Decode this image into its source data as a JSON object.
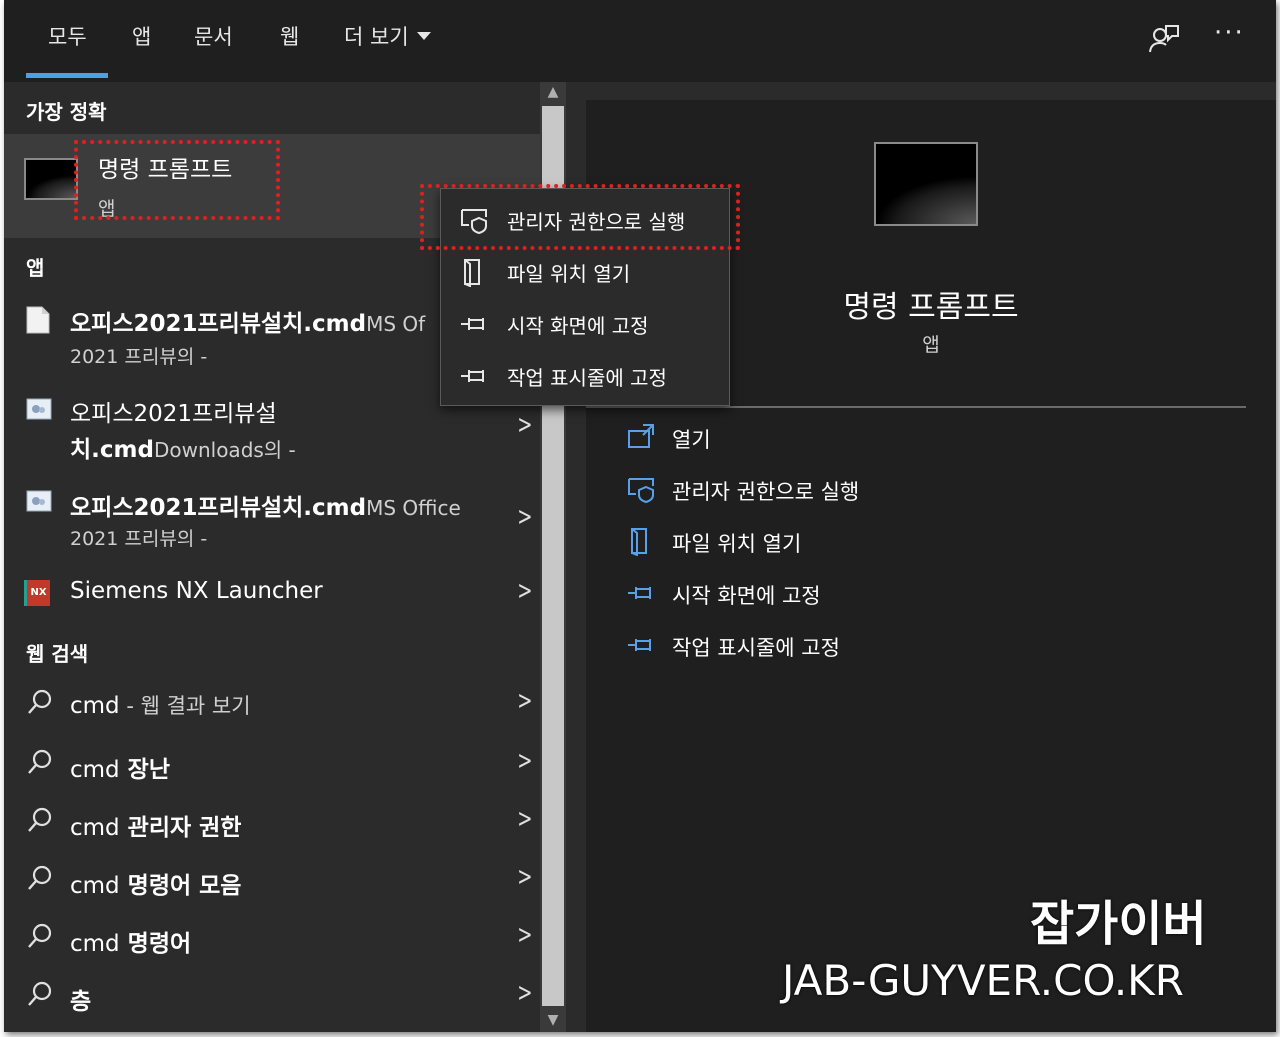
{
  "tabs": [
    {
      "label": "모두",
      "active": true
    },
    {
      "label": "앱"
    },
    {
      "label": "문서"
    },
    {
      "label": "웹"
    },
    {
      "label": "더 보기"
    }
  ],
  "header": {
    "more_label": "···",
    "feedback_icon": "feedback-icon",
    "accent": "#4aa3e0"
  },
  "best_match": {
    "section": "가장 정확",
    "title": "명령 프롬프트",
    "subtitle": "앱"
  },
  "apps": {
    "section": "앱",
    "items": [
      {
        "title_bold": "오피스2021프리뷰설치.cmd",
        "title_suffix": "MS Of",
        "subtitle": "2021 프리뷰의 -"
      },
      {
        "title_line1": "오피스2021프리뷰설",
        "title_bold": "치.cmd",
        "title_suffix": "Downloads의 -"
      },
      {
        "title_bold": "오피스2021프리뷰설치.cmd",
        "title_suffix": "MS Office",
        "subtitle": "2021 프리뷰의 -"
      },
      {
        "title": "Siemens NX Launcher",
        "icon_text": "NX"
      }
    ]
  },
  "web": {
    "section": "웹 검색",
    "items": [
      {
        "prefix": "cmd",
        "suffix": " - 웹 결과 보기"
      },
      {
        "prefix": "cmd",
        "suffix": " 장난"
      },
      {
        "prefix": "cmd",
        "suffix": " 관리자 권한"
      },
      {
        "prefix": "cmd",
        "suffix": " 명령어 모음"
      },
      {
        "prefix": "cmd",
        "suffix": " 명령어"
      },
      {
        "prefix": "",
        "suffix": "층"
      }
    ]
  },
  "context_menu": [
    {
      "label": "관리자 권한으로 실행",
      "icon": "shield-icon"
    },
    {
      "label": "파일 위치 열기",
      "icon": "file-location-icon"
    },
    {
      "label": "시작 화면에 고정",
      "icon": "pin-icon"
    },
    {
      "label": "작업 표시줄에 고정",
      "icon": "pin-icon"
    }
  ],
  "preview": {
    "title": "명령 프롬프트",
    "subtitle": "앱",
    "actions": [
      {
        "label": "열기",
        "icon": "open-icon"
      },
      {
        "label": "관리자 권한으로 실행",
        "icon": "shield-icon"
      },
      {
        "label": "파일 위치 열기",
        "icon": "file-location-icon"
      },
      {
        "label": "시작 화면에 고정",
        "icon": "pin-icon"
      },
      {
        "label": "작업 표시줄에 고정",
        "icon": "pin-icon"
      }
    ]
  },
  "watermark": {
    "line1": "잡가이버",
    "line2": "JAB-GUYVER.CO.KR"
  },
  "colors": {
    "highlight": "#e02020",
    "panel": "#2b2b2b",
    "icon_blue": "#5aa0e8"
  }
}
